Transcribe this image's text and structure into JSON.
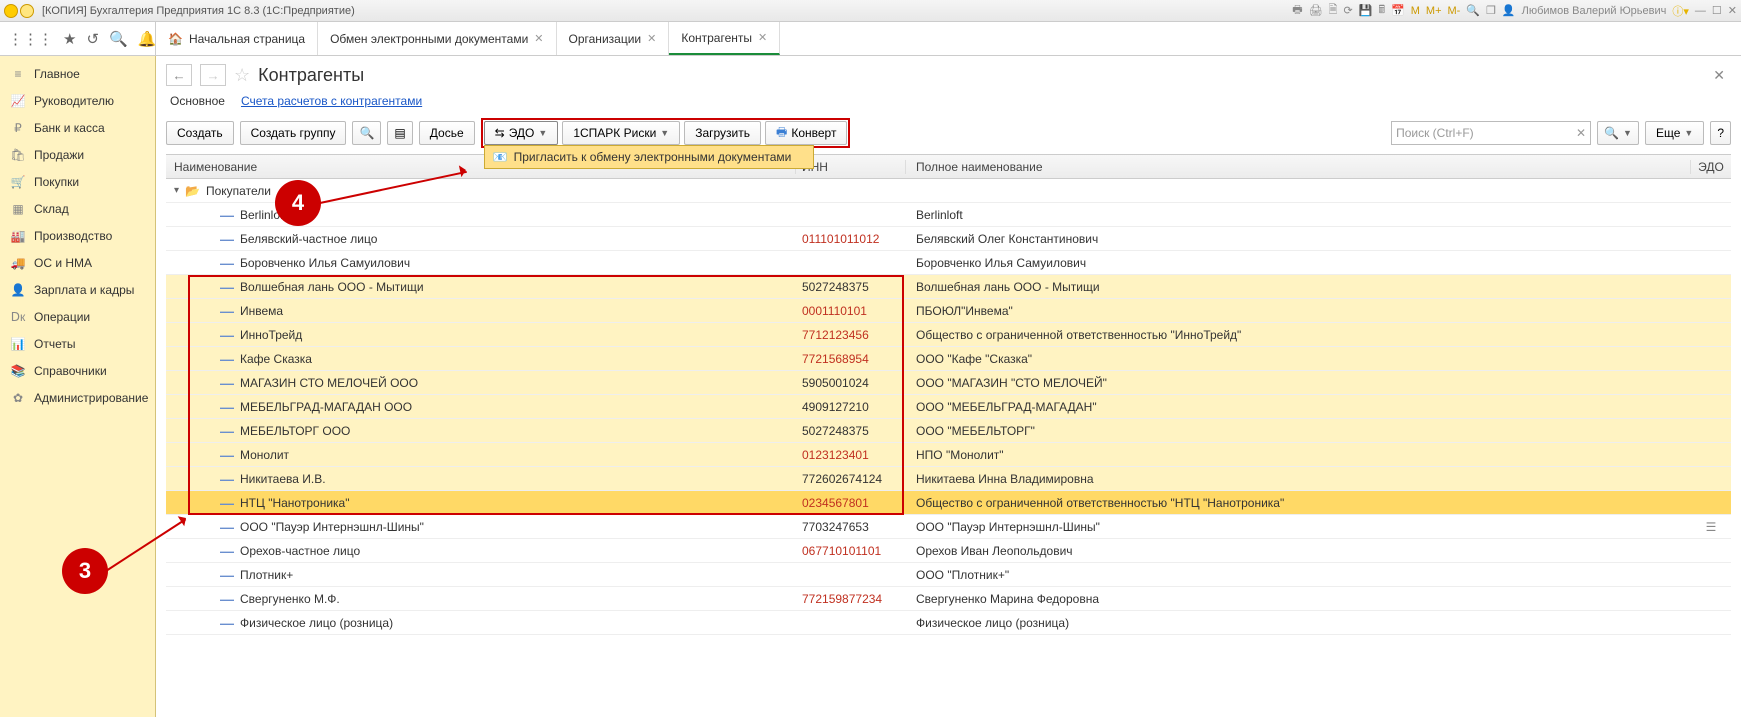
{
  "window_title": "[КОПИЯ] Бухгалтерия Предприятия 1С 8.3  (1С:Предприятие)",
  "user_name": "Любимов Валерий Юрьевич",
  "mem_buttons": [
    "M",
    "M+",
    "M-"
  ],
  "tabs": {
    "home": "Начальная страница",
    "t1": "Обмен электронными документами",
    "t2": "Организации",
    "t3": "Контрагенты"
  },
  "sidebar": [
    {
      "icon": "≡",
      "label": "Главное"
    },
    {
      "icon": "📈",
      "label": "Руководителю"
    },
    {
      "icon": "₽",
      "label": "Банк и касса"
    },
    {
      "icon": "🛍",
      "label": "Продажи"
    },
    {
      "icon": "🛒",
      "label": "Покупки"
    },
    {
      "icon": "▦",
      "label": "Склад"
    },
    {
      "icon": "🏭",
      "label": "Производство"
    },
    {
      "icon": "🚚",
      "label": "ОС и НМА"
    },
    {
      "icon": "👤",
      "label": "Зарплата и кадры"
    },
    {
      "icon": "Ⅾк",
      "label": "Операции"
    },
    {
      "icon": "📊",
      "label": "Отчеты"
    },
    {
      "icon": "📚",
      "label": "Справочники"
    },
    {
      "icon": "✿",
      "label": "Администрирование"
    }
  ],
  "page_title": "Контрагенты",
  "subnav": {
    "main": "Основное",
    "accounts": "Счета расчетов с контрагентами"
  },
  "toolbar": {
    "create": "Создать",
    "create_group": "Создать группу",
    "dossier": "Досье",
    "edo": "ЭДО",
    "spark": "1СПАРК Риски",
    "load": "Загрузить",
    "envelope": "Конверт",
    "more": "Еще"
  },
  "dropdown_item": "Пригласить к обмену электронными документами",
  "search_placeholder": "Поиск (Ctrl+F)",
  "columns": {
    "name": "Наименование",
    "inn": "ИНН",
    "full": "Полное наименование",
    "edo": "ЭДО"
  },
  "group_row": "Покупатели",
  "rows": [
    {
      "name": "Berlinloft",
      "inn": "",
      "full": "Berlinloft",
      "sel": false
    },
    {
      "name": "Белявский-частное лицо",
      "inn": "011101011012",
      "inn_red": true,
      "full": "Белявский Олег Константинович",
      "sel": false
    },
    {
      "name": "Боровченко Илья Самуилович",
      "inn": "",
      "full": "Боровченко Илья Самуилович",
      "sel": false
    },
    {
      "name": "Волшебная лань ООО - Мытищи",
      "inn": "5027248375",
      "full": "Волшебная лань ООО - Мытищи",
      "sel": true
    },
    {
      "name": "Инвема",
      "inn": "0001110101",
      "inn_red": true,
      "full": "ПБОЮЛ\"Инвема\"",
      "sel": true
    },
    {
      "name": "ИнноТрейд",
      "inn": "7712123456",
      "inn_red": true,
      "full": "Общество с ограниченной ответственностью \"ИнноТрейд\"",
      "sel": true
    },
    {
      "name": "Кафе Сказка",
      "inn": "7721568954",
      "inn_red": true,
      "full": "ООО \"Кафе \"Сказка\"",
      "sel": true
    },
    {
      "name": "МАГАЗИН СТО МЕЛОЧЕЙ ООО",
      "inn": "5905001024",
      "full": "ООО \"МАГАЗИН \"СТО МЕЛОЧЕЙ\"",
      "sel": true
    },
    {
      "name": "МЕБЕЛЬГРАД-МАГАДАН ООО",
      "inn": "4909127210",
      "full": "ООО \"МЕБЕЛЬГРАД-МАГАДАН\"",
      "sel": true
    },
    {
      "name": "МЕБЕЛЬТОРГ ООО",
      "inn": "5027248375",
      "full": "ООО \"МЕБЕЛЬТОРГ\"",
      "sel": true
    },
    {
      "name": "Монолит",
      "inn": "0123123401",
      "inn_red": true,
      "full": "НПО \"Монолит\"",
      "sel": true
    },
    {
      "name": "Никитаева И.В.",
      "inn": "772602674124",
      "full": "Никитаева Инна Владимировна",
      "sel": true
    },
    {
      "name": "НТЦ \"Нанотроника\"",
      "inn": "0234567801",
      "inn_red": true,
      "full": "Общество с ограниченной ответственностью \"НТЦ \"Нанотроника\"",
      "sel": true,
      "hl": true
    },
    {
      "name": "ООО \"Пауэр Интернэшнл-Шины\"",
      "inn": "7703247653",
      "full": "ООО \"Пауэр Интернэшнл-Шины\"",
      "sel": false,
      "edo_icon": true
    },
    {
      "name": "Орехов-частное лицо",
      "inn": "067710101101",
      "inn_red": true,
      "full": "Орехов Иван Леопольдович",
      "sel": false
    },
    {
      "name": "Плотник+",
      "inn": "",
      "full": "ООО \"Плотник+\"",
      "sel": false
    },
    {
      "name": "Свергуненко М.Ф.",
      "inn": "772159877234",
      "inn_red": true,
      "full": "Свергуненко Марина Федоровна",
      "sel": false
    },
    {
      "name": "Физическое лицо (розница)",
      "inn": "",
      "full": "Физическое лицо (розница)",
      "sel": false
    }
  ],
  "callouts": {
    "c3": "3",
    "c4": "4"
  }
}
